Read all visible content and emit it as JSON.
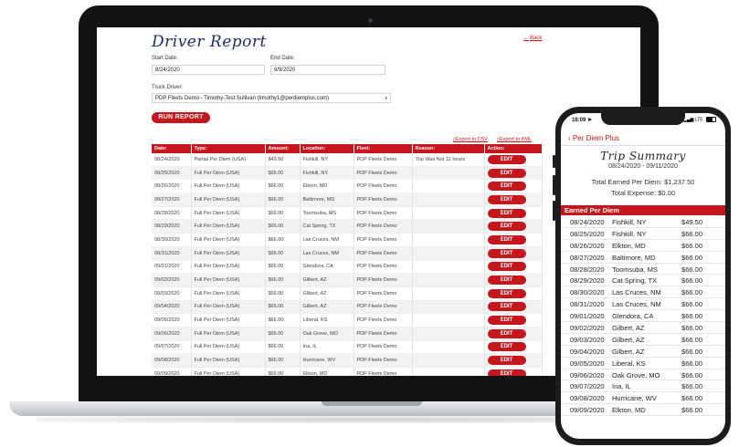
{
  "desktop": {
    "title": "Driver Report",
    "back_link": "Back",
    "start_date_label": "Start Date:",
    "start_date_value": "8/24/2020",
    "end_date_label": "End Date:",
    "end_date_value": "9/9/2020",
    "truck_driver_label": "Truck Driver:",
    "truck_driver_value": "PDP Fleets Demo - Timothy-Test Sullivan (timothy1@perdiemplus.com)",
    "run_report_label": "RUN REPORT",
    "export_csv": "Export to CSV",
    "export_kml": "Export to KML",
    "columns": [
      "Date:",
      "Type:",
      "Amount:",
      "Location:",
      "Fleet:",
      "Reason:",
      "Action:"
    ],
    "edit_label": "EDIT",
    "rows": [
      {
        "date": "08/24/2020",
        "type": "Partial Per Diem (USA)",
        "amount": "$49.50",
        "location": "Fishkill, NY",
        "fleet": "PDP Fleets Demo",
        "reason": "Trip Was Not 12 hours"
      },
      {
        "date": "08/25/2020",
        "type": "Full Per Diem (USA)",
        "amount": "$66.00",
        "location": "Fishkill, NY",
        "fleet": "PDP Fleets Demo",
        "reason": ""
      },
      {
        "date": "08/26/2020",
        "type": "Full Per Diem (USA)",
        "amount": "$66.00",
        "location": "Elkton, MD",
        "fleet": "PDP Fleets Demo",
        "reason": ""
      },
      {
        "date": "08/27/2020",
        "type": "Full Per Diem (USA)",
        "amount": "$66.00",
        "location": "Baltimore, MD",
        "fleet": "PDP Fleets Demo",
        "reason": ""
      },
      {
        "date": "08/28/2020",
        "type": "Full Per Diem (USA)",
        "amount": "$66.00",
        "location": "Toomsuba, MS",
        "fleet": "PDP Fleets Demo",
        "reason": ""
      },
      {
        "date": "08/29/2020",
        "type": "Full Per Diem (USA)",
        "amount": "$66.00",
        "location": "Cat Spring, TX",
        "fleet": "PDP Fleets Demo",
        "reason": ""
      },
      {
        "date": "08/30/2020",
        "type": "Full Per Diem (USA)",
        "amount": "$66.00",
        "location": "Las Cruces, NM",
        "fleet": "PDP Fleets Demo",
        "reason": ""
      },
      {
        "date": "08/31/2020",
        "type": "Full Per Diem (USA)",
        "amount": "$66.00",
        "location": "Las Cruces, NM",
        "fleet": "PDP Fleets Demo",
        "reason": ""
      },
      {
        "date": "09/01/2020",
        "type": "Full Per Diem (USA)",
        "amount": "$66.00",
        "location": "Glendora, CA",
        "fleet": "PDP Fleets Demo",
        "reason": ""
      },
      {
        "date": "09/02/2020",
        "type": "Full Per Diem (USA)",
        "amount": "$66.00",
        "location": "Gilbert, AZ",
        "fleet": "PDP Fleets Demo",
        "reason": ""
      },
      {
        "date": "09/03/2020",
        "type": "Full Per Diem (USA)",
        "amount": "$66.00",
        "location": "Gilbert, AZ",
        "fleet": "PDP Fleets Demo",
        "reason": ""
      },
      {
        "date": "09/04/2020",
        "type": "Full Per Diem (USA)",
        "amount": "$66.00",
        "location": "Gilbert, AZ",
        "fleet": "PDP Fleets Demo",
        "reason": ""
      },
      {
        "date": "09/05/2020",
        "type": "Full Per Diem (USA)",
        "amount": "$66.00",
        "location": "Liberal, KS",
        "fleet": "PDP Fleets Demo",
        "reason": ""
      },
      {
        "date": "09/06/2020",
        "type": "Full Per Diem (USA)",
        "amount": "$66.00",
        "location": "Oak Grove, MO",
        "fleet": "PDP Fleets Demo",
        "reason": ""
      },
      {
        "date": "09/07/2020",
        "type": "Full Per Diem (USA)",
        "amount": "$66.00",
        "location": "Ina, IL",
        "fleet": "PDP Fleets Demo",
        "reason": ""
      },
      {
        "date": "09/08/2020",
        "type": "Full Per Diem (USA)",
        "amount": "$66.00",
        "location": "Hurricane, WV",
        "fleet": "PDP Fleets Demo",
        "reason": ""
      },
      {
        "date": "09/09/2020",
        "type": "Full Per Diem (USA)",
        "amount": "$66.00",
        "location": "Elkton, MD",
        "fleet": "PDP Fleets Demo",
        "reason": ""
      }
    ]
  },
  "mobile": {
    "status_time": "16:09",
    "status_network": "LTE",
    "back_label": "Per Diem Plus",
    "title": "Trip Summary",
    "date_range": "08/24/2020 - 09/11/2020",
    "total_earned": "Total Earned Per Diem: $1,237.50",
    "total_expense": "Total Expense: $0.00",
    "section_label": "Earned Per Diem",
    "rows": [
      {
        "date": "08/24/2020",
        "location": "Fishkill, NY",
        "amount": "$49.50"
      },
      {
        "date": "08/25/2020",
        "location": "Fishkill, NY",
        "amount": "$66.00"
      },
      {
        "date": "08/26/2020",
        "location": "Elkton, MD",
        "amount": "$66.00"
      },
      {
        "date": "08/27/2020",
        "location": "Baltimore, MD",
        "amount": "$66.00"
      },
      {
        "date": "08/28/2020",
        "location": "Toomsuba, MS",
        "amount": "$66.00"
      },
      {
        "date": "08/29/2020",
        "location": "Cat Spring, TX",
        "amount": "$66.00"
      },
      {
        "date": "08/30/2020",
        "location": "Las Cruces, NM",
        "amount": "$66.00"
      },
      {
        "date": "08/31/2020",
        "location": "Las Cruces, NM",
        "amount": "$66.00"
      },
      {
        "date": "09/01/2020",
        "location": "Glendora, CA",
        "amount": "$66.00"
      },
      {
        "date": "09/02/2020",
        "location": "Gilbert, AZ",
        "amount": "$66.00"
      },
      {
        "date": "09/03/2020",
        "location": "Gilbert, AZ",
        "amount": "$66.00"
      },
      {
        "date": "09/04/2020",
        "location": "Gilbert, AZ",
        "amount": "$66.00"
      },
      {
        "date": "09/05/2020",
        "location": "Liberal, KS",
        "amount": "$66.00"
      },
      {
        "date": "09/06/2020",
        "location": "Oak Grove, MO",
        "amount": "$66.00"
      },
      {
        "date": "09/07/2020",
        "location": "Ina, IL",
        "amount": "$66.00"
      },
      {
        "date": "09/08/2020",
        "location": "Hurricane, WV",
        "amount": "$66.00"
      },
      {
        "date": "09/09/2020",
        "location": "Elkton, MD",
        "amount": "$66.00"
      }
    ]
  },
  "colors": {
    "accent": "#c4161c",
    "title_blue": "#1f2a6e",
    "device": "#111214"
  }
}
